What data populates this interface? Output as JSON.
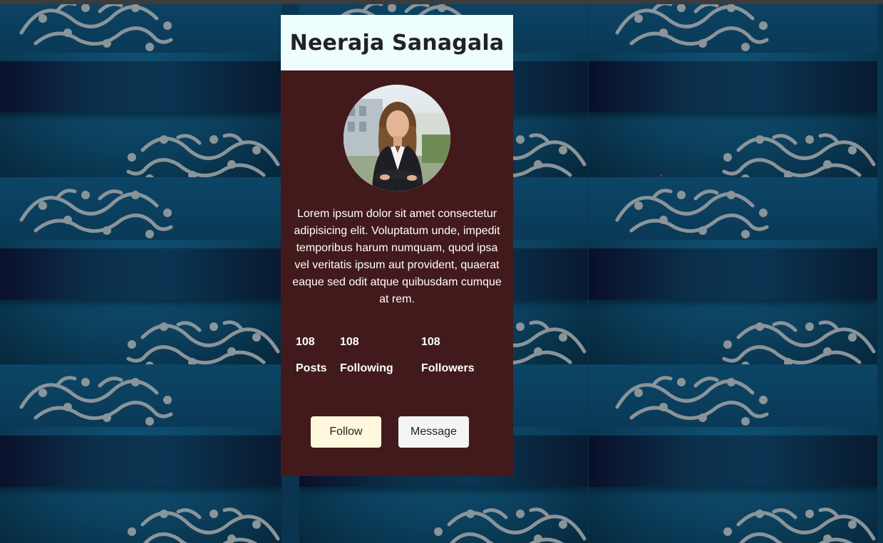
{
  "profile": {
    "name": "Neeraja Sanagala",
    "bio": "Lorem ipsum dolor sit amet consectetur adipisicing elit. Voluptatum unde, impedit temporibus harum numquam, quod ipsa vel veritatis ipsum aut provident, quaerat eaque sed odit atque quibusdam cumque at rem.",
    "avatar_icon": "profile-photo"
  },
  "stats": [
    {
      "value": "108",
      "label": "Posts"
    },
    {
      "value": "108",
      "label": "Following"
    },
    {
      "value": "108",
      "label": "Followers"
    }
  ],
  "actions": {
    "follow_label": "Follow",
    "message_label": "Message"
  },
  "colors": {
    "card_background": "#421a1b",
    "header_background": "#eefefe",
    "follow_button": "#fff8dd",
    "message_button": "#f3f4f6",
    "page_background": "#0a3550"
  }
}
